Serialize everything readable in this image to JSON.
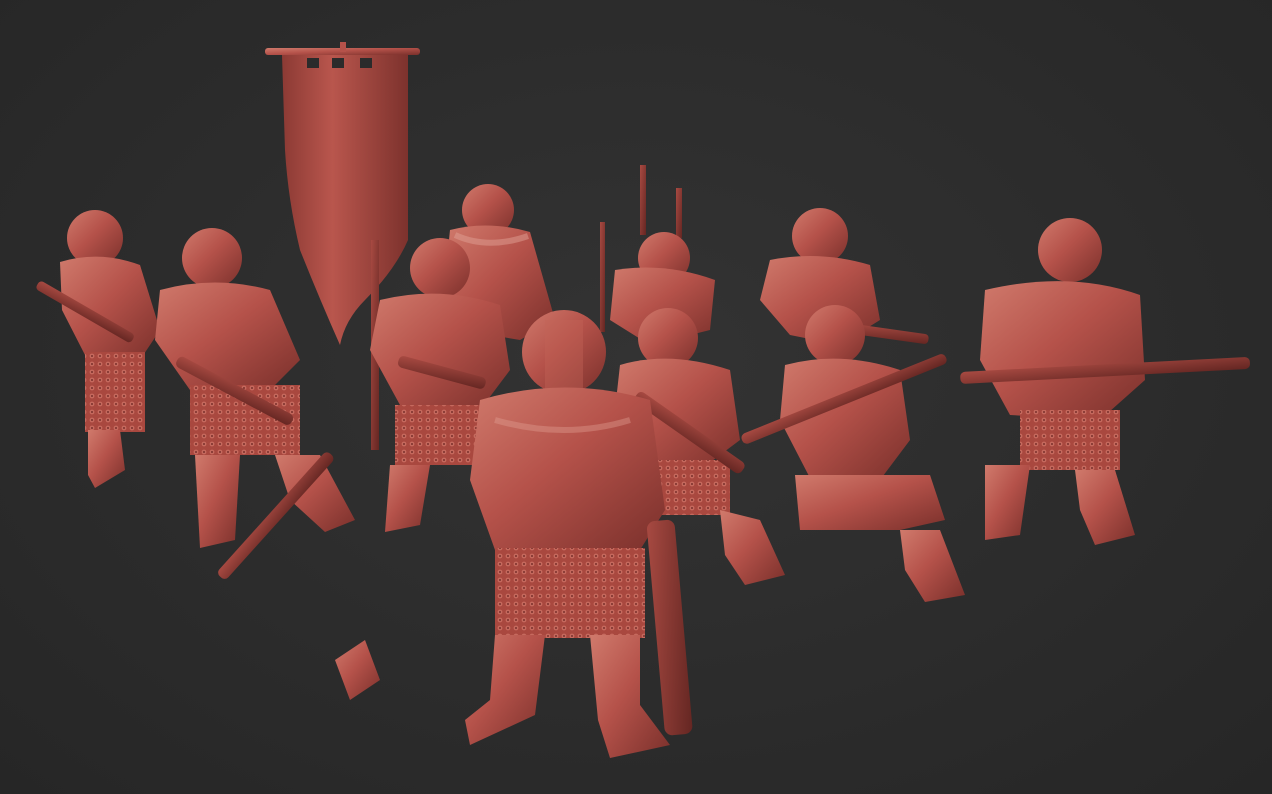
{
  "scene": {
    "background_color": "#2d2d2d",
    "model_color": "#b5524a",
    "model_shadow_color": "#6e2c28",
    "model_highlight_color": "#d27a6e",
    "subject": "miniature-squad-render",
    "figures": [
      {
        "id": "rifleman-far-left",
        "pose": "aiming"
      },
      {
        "id": "rifleman-left",
        "pose": "aiming"
      },
      {
        "id": "standard-bearer",
        "pose": "holding-banner"
      },
      {
        "id": "rear-center",
        "pose": "standing"
      },
      {
        "id": "vox-operator",
        "pose": "kneeling"
      },
      {
        "id": "rear-right",
        "pose": "standing"
      },
      {
        "id": "sergeant-front",
        "pose": "standing-with-axe"
      },
      {
        "id": "trooper-center",
        "pose": "kneeling-aiming"
      },
      {
        "id": "trooper-right",
        "pose": "kneeling-aiming"
      },
      {
        "id": "sniper-far-right",
        "pose": "aiming-long-rifle"
      }
    ],
    "banner": {
      "present": true
    }
  }
}
